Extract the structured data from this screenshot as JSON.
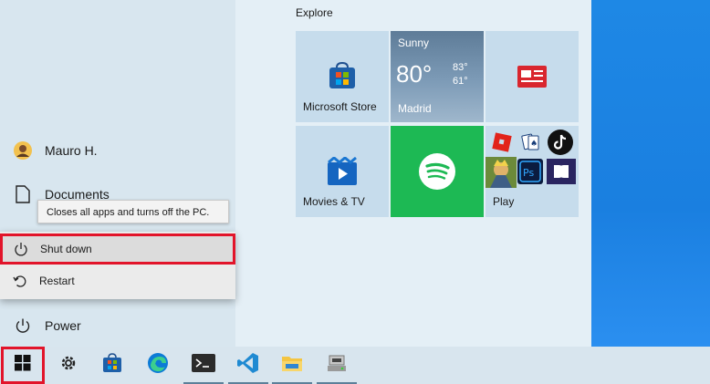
{
  "start_menu": {
    "user_name": "Mauro H.",
    "documents_label": "Documents",
    "power_label": "Power",
    "tooltip": "Closes all apps and turns off the PC.",
    "power_options": [
      {
        "label": "Shut down",
        "icon": "power-icon",
        "selected": true
      },
      {
        "label": "Restart",
        "icon": "restart-icon",
        "selected": false
      }
    ]
  },
  "tiles": {
    "group_label": "Explore",
    "microsoft_store": "Microsoft Store",
    "weather": {
      "condition": "Sunny",
      "temp": "80°",
      "high": "83°",
      "low": "61°",
      "city": "Madrid"
    },
    "movies_tv": "Movies & TV",
    "play": "Play"
  },
  "taskbar": {
    "items": [
      "windows-start-icon",
      "settings-icon",
      "store-icon",
      "edge-icon",
      "terminal-icon",
      "vscode-icon",
      "file-explorer-icon",
      "network-drive-icon"
    ]
  },
  "colors": {
    "highlight": "#e2142a",
    "spotify_green": "#1db954"
  }
}
